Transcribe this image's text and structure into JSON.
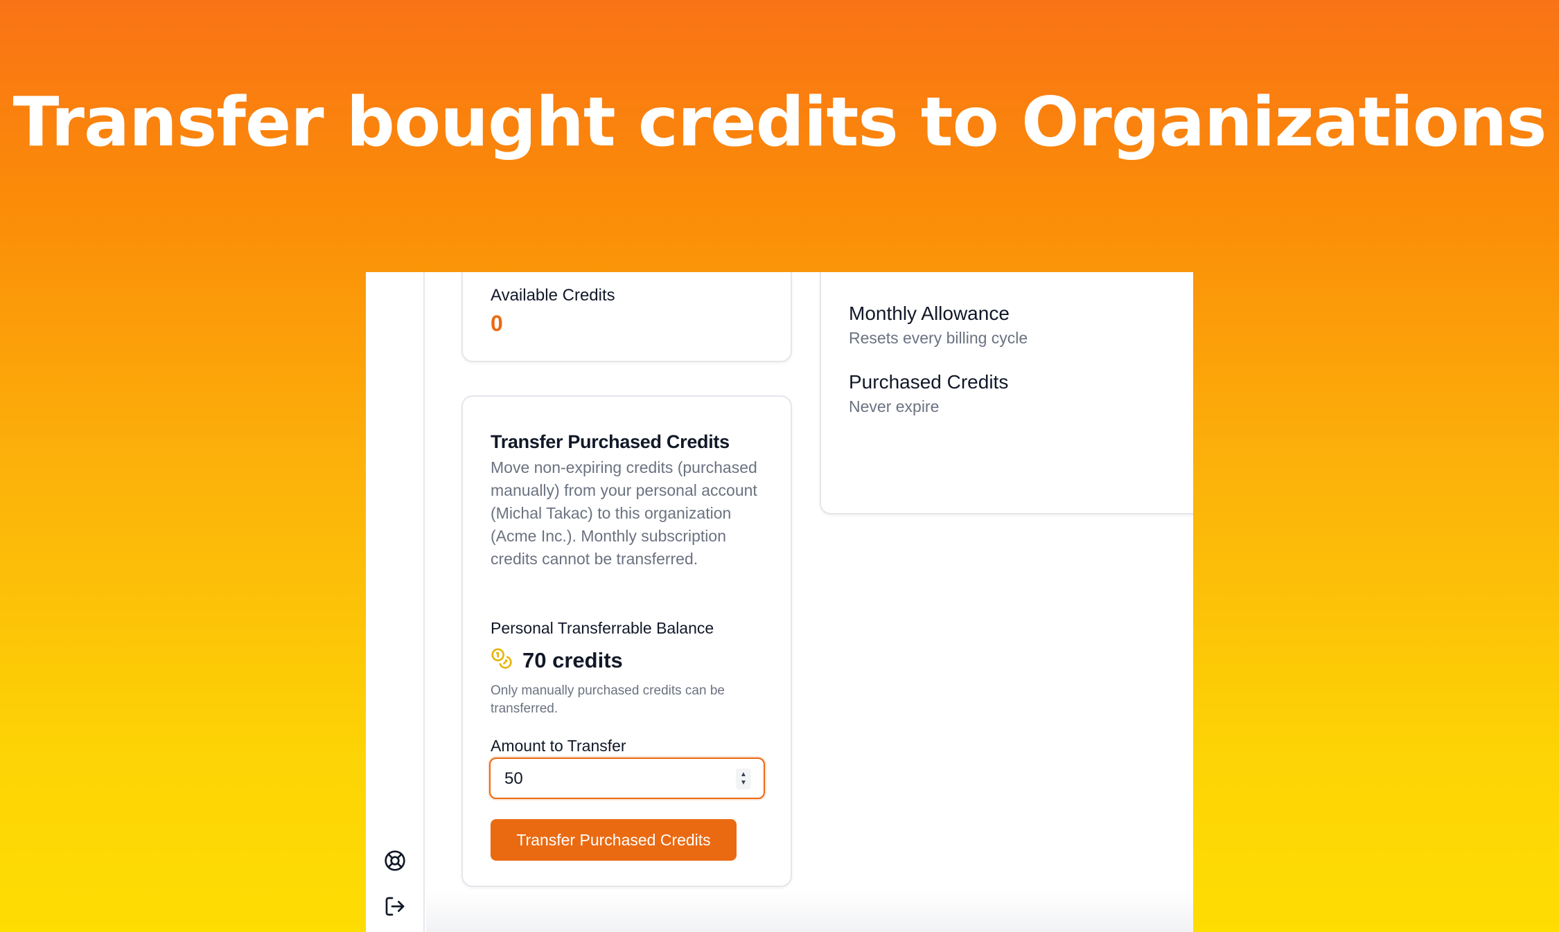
{
  "hero": {
    "title": "Transfer bought credits to Organizations"
  },
  "sidebar": {
    "icons": [
      {
        "name": "help-icon"
      },
      {
        "name": "logout-icon"
      }
    ]
  },
  "available": {
    "label": "Available Credits",
    "value": "0"
  },
  "info": {
    "monthly_title": "Monthly Allowance",
    "monthly_sub": "Resets every billing cycle",
    "purchased_title": "Purchased Credits",
    "purchased_sub": "Never expire"
  },
  "transfer": {
    "title": "Transfer Purchased Credits",
    "description": "Move non-expiring credits (purchased manually) from your personal account (Michal Takac) to this organization (Acme Inc.). Monthly subscription credits cannot be transferred.",
    "balance_label": "Personal Transferrable Balance",
    "balance_value": "70 credits",
    "balance_note": "Only manually purchased credits can be transferred.",
    "amount_label": "Amount to Transfer",
    "amount_value": "50",
    "button_label": "Transfer Purchased Credits"
  },
  "colors": {
    "accent": "#ea6a12",
    "coin": "#e5b50a"
  }
}
